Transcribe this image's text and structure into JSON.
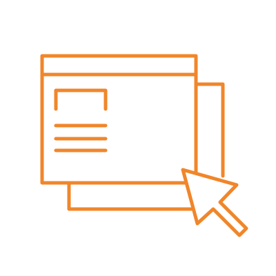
{
  "icon": {
    "name": "web-windows-with-cursor-icon",
    "stroke_color": "#F0862A",
    "background_color": "#FFFFFF"
  }
}
